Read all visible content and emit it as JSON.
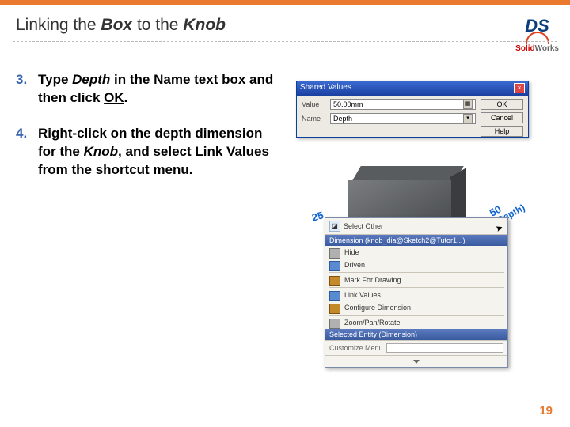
{
  "header": {
    "title_pre": "Linking the ",
    "title_b1": "Box",
    "title_mid": " to the ",
    "title_b2": "Knob",
    "logo_brand_a": "Solid",
    "logo_brand_b": "Works"
  },
  "steps": [
    {
      "num": "3.",
      "parts": {
        "a": "Type ",
        "b": "Depth",
        "c": " in the ",
        "d": "Name",
        "e": " text box and then click ",
        "f": "OK",
        "g": "."
      }
    },
    {
      "num": "4.",
      "parts": {
        "a": "Right-click on the depth dimension for the ",
        "b": "Knob",
        "c": ", and select ",
        "d": "Link Values",
        "e": " from the shortcut menu."
      }
    }
  ],
  "dialog": {
    "title": "Shared Values",
    "value_label": "Value",
    "value_text": "50.00mm",
    "name_label": "Name",
    "name_text": "Depth",
    "ok": "OK",
    "cancel": "Cancel",
    "help": "Help"
  },
  "scene": {
    "dim25": "25",
    "dim50": "50",
    "dim50_label": "(Depth)"
  },
  "context": {
    "select_other": "Select Other",
    "header": "Dimension (knob_dia@Sketch2@Tutor1...)",
    "items": [
      "Hide",
      "Driven",
      "Mark For Drawing",
      "Link Values...",
      "Configure Dimension",
      "Zoom/Pan/Rotate"
    ],
    "select_hdr": "Selected Entity (Dimension)",
    "customize": "Customize Menu"
  },
  "page_number": "19"
}
